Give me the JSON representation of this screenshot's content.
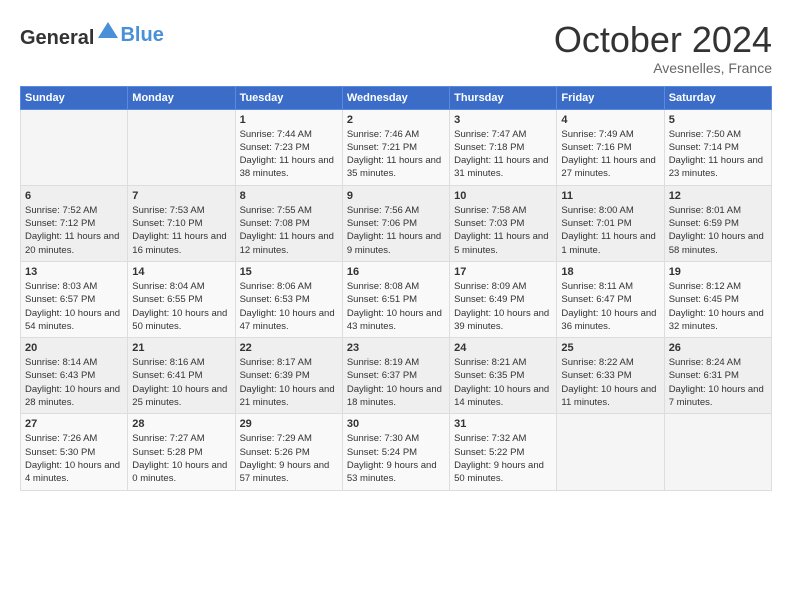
{
  "header": {
    "logo_general": "General",
    "logo_blue": "Blue",
    "month_title": "October 2024",
    "location": "Avesnelles, France"
  },
  "days_of_week": [
    "Sunday",
    "Monday",
    "Tuesday",
    "Wednesday",
    "Thursday",
    "Friday",
    "Saturday"
  ],
  "weeks": [
    [
      {
        "day": "",
        "sunrise": "",
        "sunset": "",
        "daylight": ""
      },
      {
        "day": "",
        "sunrise": "",
        "sunset": "",
        "daylight": ""
      },
      {
        "day": "1",
        "sunrise": "Sunrise: 7:44 AM",
        "sunset": "Sunset: 7:23 PM",
        "daylight": "Daylight: 11 hours and 38 minutes."
      },
      {
        "day": "2",
        "sunrise": "Sunrise: 7:46 AM",
        "sunset": "Sunset: 7:21 PM",
        "daylight": "Daylight: 11 hours and 35 minutes."
      },
      {
        "day": "3",
        "sunrise": "Sunrise: 7:47 AM",
        "sunset": "Sunset: 7:18 PM",
        "daylight": "Daylight: 11 hours and 31 minutes."
      },
      {
        "day": "4",
        "sunrise": "Sunrise: 7:49 AM",
        "sunset": "Sunset: 7:16 PM",
        "daylight": "Daylight: 11 hours and 27 minutes."
      },
      {
        "day": "5",
        "sunrise": "Sunrise: 7:50 AM",
        "sunset": "Sunset: 7:14 PM",
        "daylight": "Daylight: 11 hours and 23 minutes."
      }
    ],
    [
      {
        "day": "6",
        "sunrise": "Sunrise: 7:52 AM",
        "sunset": "Sunset: 7:12 PM",
        "daylight": "Daylight: 11 hours and 20 minutes."
      },
      {
        "day": "7",
        "sunrise": "Sunrise: 7:53 AM",
        "sunset": "Sunset: 7:10 PM",
        "daylight": "Daylight: 11 hours and 16 minutes."
      },
      {
        "day": "8",
        "sunrise": "Sunrise: 7:55 AM",
        "sunset": "Sunset: 7:08 PM",
        "daylight": "Daylight: 11 hours and 12 minutes."
      },
      {
        "day": "9",
        "sunrise": "Sunrise: 7:56 AM",
        "sunset": "Sunset: 7:06 PM",
        "daylight": "Daylight: 11 hours and 9 minutes."
      },
      {
        "day": "10",
        "sunrise": "Sunrise: 7:58 AM",
        "sunset": "Sunset: 7:03 PM",
        "daylight": "Daylight: 11 hours and 5 minutes."
      },
      {
        "day": "11",
        "sunrise": "Sunrise: 8:00 AM",
        "sunset": "Sunset: 7:01 PM",
        "daylight": "Daylight: 11 hours and 1 minute."
      },
      {
        "day": "12",
        "sunrise": "Sunrise: 8:01 AM",
        "sunset": "Sunset: 6:59 PM",
        "daylight": "Daylight: 10 hours and 58 minutes."
      }
    ],
    [
      {
        "day": "13",
        "sunrise": "Sunrise: 8:03 AM",
        "sunset": "Sunset: 6:57 PM",
        "daylight": "Daylight: 10 hours and 54 minutes."
      },
      {
        "day": "14",
        "sunrise": "Sunrise: 8:04 AM",
        "sunset": "Sunset: 6:55 PM",
        "daylight": "Daylight: 10 hours and 50 minutes."
      },
      {
        "day": "15",
        "sunrise": "Sunrise: 8:06 AM",
        "sunset": "Sunset: 6:53 PM",
        "daylight": "Daylight: 10 hours and 47 minutes."
      },
      {
        "day": "16",
        "sunrise": "Sunrise: 8:08 AM",
        "sunset": "Sunset: 6:51 PM",
        "daylight": "Daylight: 10 hours and 43 minutes."
      },
      {
        "day": "17",
        "sunrise": "Sunrise: 8:09 AM",
        "sunset": "Sunset: 6:49 PM",
        "daylight": "Daylight: 10 hours and 39 minutes."
      },
      {
        "day": "18",
        "sunrise": "Sunrise: 8:11 AM",
        "sunset": "Sunset: 6:47 PM",
        "daylight": "Daylight: 10 hours and 36 minutes."
      },
      {
        "day": "19",
        "sunrise": "Sunrise: 8:12 AM",
        "sunset": "Sunset: 6:45 PM",
        "daylight": "Daylight: 10 hours and 32 minutes."
      }
    ],
    [
      {
        "day": "20",
        "sunrise": "Sunrise: 8:14 AM",
        "sunset": "Sunset: 6:43 PM",
        "daylight": "Daylight: 10 hours and 28 minutes."
      },
      {
        "day": "21",
        "sunrise": "Sunrise: 8:16 AM",
        "sunset": "Sunset: 6:41 PM",
        "daylight": "Daylight: 10 hours and 25 minutes."
      },
      {
        "day": "22",
        "sunrise": "Sunrise: 8:17 AM",
        "sunset": "Sunset: 6:39 PM",
        "daylight": "Daylight: 10 hours and 21 minutes."
      },
      {
        "day": "23",
        "sunrise": "Sunrise: 8:19 AM",
        "sunset": "Sunset: 6:37 PM",
        "daylight": "Daylight: 10 hours and 18 minutes."
      },
      {
        "day": "24",
        "sunrise": "Sunrise: 8:21 AM",
        "sunset": "Sunset: 6:35 PM",
        "daylight": "Daylight: 10 hours and 14 minutes."
      },
      {
        "day": "25",
        "sunrise": "Sunrise: 8:22 AM",
        "sunset": "Sunset: 6:33 PM",
        "daylight": "Daylight: 10 hours and 11 minutes."
      },
      {
        "day": "26",
        "sunrise": "Sunrise: 8:24 AM",
        "sunset": "Sunset: 6:31 PM",
        "daylight": "Daylight: 10 hours and 7 minutes."
      }
    ],
    [
      {
        "day": "27",
        "sunrise": "Sunrise: 7:26 AM",
        "sunset": "Sunset: 5:30 PM",
        "daylight": "Daylight: 10 hours and 4 minutes."
      },
      {
        "day": "28",
        "sunrise": "Sunrise: 7:27 AM",
        "sunset": "Sunset: 5:28 PM",
        "daylight": "Daylight: 10 hours and 0 minutes."
      },
      {
        "day": "29",
        "sunrise": "Sunrise: 7:29 AM",
        "sunset": "Sunset: 5:26 PM",
        "daylight": "Daylight: 9 hours and 57 minutes."
      },
      {
        "day": "30",
        "sunrise": "Sunrise: 7:30 AM",
        "sunset": "Sunset: 5:24 PM",
        "daylight": "Daylight: 9 hours and 53 minutes."
      },
      {
        "day": "31",
        "sunrise": "Sunrise: 7:32 AM",
        "sunset": "Sunset: 5:22 PM",
        "daylight": "Daylight: 9 hours and 50 minutes."
      },
      {
        "day": "",
        "sunrise": "",
        "sunset": "",
        "daylight": ""
      },
      {
        "day": "",
        "sunrise": "",
        "sunset": "",
        "daylight": ""
      }
    ]
  ]
}
